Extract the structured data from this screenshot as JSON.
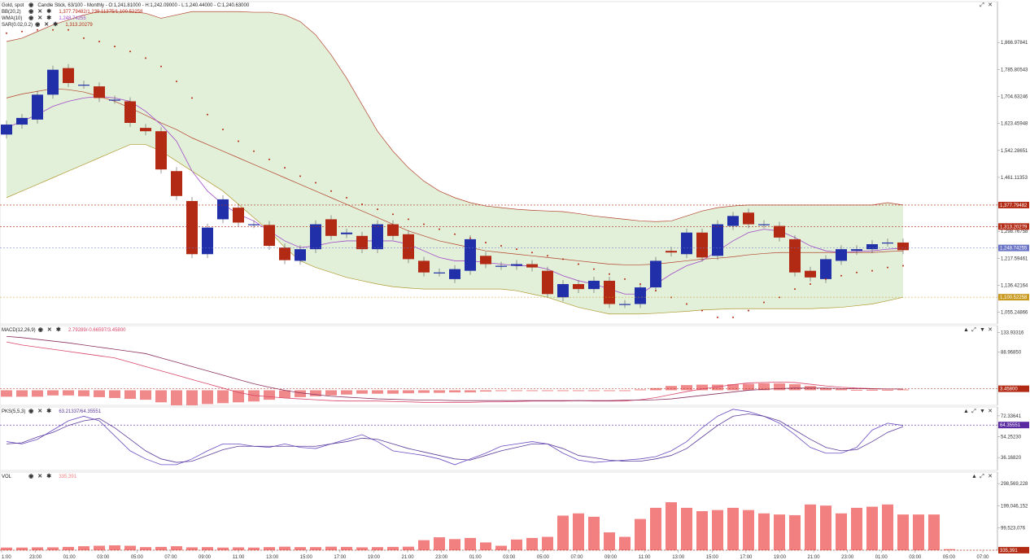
{
  "colors": {
    "up": "#2130a8",
    "down": "#b22a14",
    "band_fill": "#e2efd9",
    "band_line": "#b4442c",
    "wma": "#a04bc8",
    "sar": "#b22a14",
    "macd_line": "#d8466a",
    "macd_hist": "#f08a8a",
    "pk_k": "#6a4cc0",
    "pk_d": "#5a3a9a",
    "vol": "#f28080",
    "tag_red": "#b22a14",
    "tag_gold": "#c89a20",
    "tag_blue": "#6a74c6",
    "tag_purple": "#5a2aa0"
  },
  "legend": {
    "main": {
      "name": "Gold, spot",
      "info": "Candle Stick, 63/100 - Monthly - O:1,241.81000 - H:1,242.09000 - L:1,240.44000 - C:1,240.63000"
    },
    "bb": {
      "name": "BB(20,2)",
      "values": "1,377.79482/1,239.11375/1,100.52258"
    },
    "wma": {
      "name": "WMA(10)",
      "values": "1,248.74255"
    },
    "sar": {
      "name": "SAR(0.02,0.2)",
      "values": "1,313.20279"
    },
    "macd": {
      "name": "MACD(12,26,9)",
      "values": "2.79289/-0.66597/3.45800"
    },
    "pks": {
      "name": "PKS(5,5,3)",
      "values": "63.21337/64.35551"
    },
    "vol": {
      "name": "VOL",
      "values": "335,391"
    }
  },
  "icons": {
    "eye": "eye-icon",
    "close": "close-icon",
    "settings": "gear-icon",
    "expand": "expand-icon",
    "collapse": "collapse-icon",
    "up": "arrow-up-icon",
    "down": "arrow-down-icon"
  },
  "chart_data": [
    {
      "type": "candlestick",
      "panel": "price",
      "ylim": [
        1020,
        1990
      ],
      "yticks": [
        "1,866.97841",
        "1,785.80543",
        "1,704.63246",
        "1,623.45948",
        "1,542.28651",
        "1,461.11353",
        "1,379.94056",
        "1,298.76758",
        "1,217.59461",
        "1,136.42164",
        "1,055.24866"
      ],
      "ytick_values": [
        1866.98,
        1785.81,
        1704.63,
        1623.46,
        1542.29,
        1461.11,
        1379.94,
        1298.77,
        1217.59,
        1136.42,
        1055.25
      ],
      "tags": [
        {
          "text": "1,377.79482",
          "value": 1377.79,
          "color": "red"
        },
        {
          "text": "1,313.20279",
          "value": 1313.2,
          "color": "red"
        },
        {
          "text": "1,248.74255",
          "value": 1248.74,
          "color": "blue"
        },
        {
          "text": "1,100.52258",
          "value": 1100.52,
          "color": "gold"
        }
      ],
      "candles": [
        {
          "o": 1590,
          "c": 1620
        },
        {
          "o": 1620,
          "c": 1640
        },
        {
          "o": 1635,
          "c": 1710
        },
        {
          "o": 1710,
          "c": 1785
        },
        {
          "o": 1790,
          "c": 1745
        },
        {
          "o": 1740,
          "c": 1740
        },
        {
          "o": 1735,
          "c": 1700
        },
        {
          "o": 1695,
          "c": 1695
        },
        {
          "o": 1690,
          "c": 1625
        },
        {
          "o": 1610,
          "c": 1600
        },
        {
          "o": 1600,
          "c": 1485
        },
        {
          "o": 1480,
          "c": 1405
        },
        {
          "o": 1390,
          "c": 1230
        },
        {
          "o": 1230,
          "c": 1310
        },
        {
          "o": 1335,
          "c": 1395
        },
        {
          "o": 1370,
          "c": 1325
        },
        {
          "o": 1320,
          "c": 1320
        },
        {
          "o": 1318,
          "c": 1255
        },
        {
          "o": 1250,
          "c": 1212
        },
        {
          "o": 1210,
          "c": 1245
        },
        {
          "o": 1245,
          "c": 1320
        },
        {
          "o": 1335,
          "c": 1285
        },
        {
          "o": 1290,
          "c": 1295
        },
        {
          "o": 1285,
          "c": 1245
        },
        {
          "o": 1245,
          "c": 1320
        },
        {
          "o": 1320,
          "c": 1285
        },
        {
          "o": 1290,
          "c": 1215
        },
        {
          "o": 1210,
          "c": 1175
        },
        {
          "o": 1175,
          "c": 1175
        },
        {
          "o": 1155,
          "c": 1185
        },
        {
          "o": 1180,
          "c": 1275
        },
        {
          "o": 1225,
          "c": 1200
        },
        {
          "o": 1195,
          "c": 1195
        },
        {
          "o": 1195,
          "c": 1200
        },
        {
          "o": 1200,
          "c": 1190
        },
        {
          "o": 1180,
          "c": 1110
        },
        {
          "o": 1100,
          "c": 1140
        },
        {
          "o": 1140,
          "c": 1125
        },
        {
          "o": 1125,
          "c": 1150
        },
        {
          "o": 1150,
          "c": 1080
        },
        {
          "o": 1080,
          "c": 1080
        },
        {
          "o": 1080,
          "c": 1130
        },
        {
          "o": 1130,
          "c": 1210
        },
        {
          "o": 1240,
          "c": 1235
        },
        {
          "o": 1230,
          "c": 1295
        },
        {
          "o": 1295,
          "c": 1220
        },
        {
          "o": 1225,
          "c": 1320
        },
        {
          "o": 1315,
          "c": 1345
        },
        {
          "o": 1355,
          "c": 1320
        },
        {
          "o": 1320,
          "c": 1320
        },
        {
          "o": 1315,
          "c": 1280
        },
        {
          "o": 1275,
          "c": 1175
        },
        {
          "o": 1180,
          "c": 1160
        },
        {
          "o": 1155,
          "c": 1215
        },
        {
          "o": 1210,
          "c": 1245
        },
        {
          "o": 1240,
          "c": 1245
        },
        {
          "o": 1245,
          "c": 1260
        },
        {
          "o": 1265,
          "c": 1265
        },
        {
          "o": 1265,
          "c": 1242
        }
      ],
      "bb_upper": [
        1870,
        1880,
        1900,
        1920,
        1935,
        1950,
        1960,
        1960,
        1960,
        1955,
        1940,
        1950,
        1960,
        1960,
        1960,
        1960,
        1958,
        1958,
        1950,
        1930,
        1890,
        1830,
        1760,
        1680,
        1600,
        1540,
        1490,
        1450,
        1420,
        1400,
        1385,
        1375,
        1370,
        1365,
        1362,
        1360,
        1358,
        1352,
        1345,
        1340,
        1335,
        1330,
        1328,
        1330,
        1345,
        1360,
        1370,
        1375,
        1378,
        1378,
        1378,
        1378,
        1378,
        1378,
        1378,
        1378,
        1378,
        1385,
        1378
      ],
      "bb_mid": [
        1700,
        1712,
        1720,
        1728,
        1725,
        1718,
        1705,
        1690,
        1670,
        1648,
        1625,
        1605,
        1580,
        1560,
        1540,
        1520,
        1500,
        1480,
        1460,
        1440,
        1420,
        1400,
        1380,
        1360,
        1340,
        1320,
        1300,
        1285,
        1270,
        1260,
        1250,
        1240,
        1235,
        1230,
        1225,
        1220,
        1215,
        1210,
        1205,
        1200,
        1198,
        1198,
        1200,
        1205,
        1210,
        1215,
        1218,
        1222,
        1228,
        1232,
        1235,
        1235,
        1235,
        1235,
        1235,
        1235,
        1235,
        1238,
        1240
      ],
      "bb_lower": [
        1400,
        1420,
        1440,
        1460,
        1480,
        1500,
        1520,
        1540,
        1560,
        1560,
        1540,
        1510,
        1480,
        1450,
        1420,
        1380,
        1340,
        1300,
        1250,
        1210,
        1190,
        1175,
        1160,
        1150,
        1140,
        1132,
        1128,
        1125,
        1125,
        1125,
        1125,
        1125,
        1125,
        1120,
        1110,
        1100,
        1085,
        1070,
        1060,
        1050,
        1050,
        1050,
        1052,
        1055,
        1058,
        1062,
        1064,
        1066,
        1066,
        1066,
        1066,
        1066,
        1066,
        1068,
        1070,
        1075,
        1080,
        1090,
        1100
      ],
      "wma": [
        1610,
        1630,
        1650,
        1675,
        1690,
        1700,
        1705,
        1700,
        1690,
        1660,
        1620,
        1570,
        1480,
        1420,
        1380,
        1350,
        1330,
        1300,
        1270,
        1250,
        1255,
        1265,
        1270,
        1270,
        1270,
        1270,
        1260,
        1240,
        1220,
        1210,
        1210,
        1205,
        1200,
        1195,
        1195,
        1185,
        1165,
        1150,
        1140,
        1125,
        1110,
        1110,
        1140,
        1170,
        1195,
        1210,
        1240,
        1270,
        1295,
        1305,
        1300,
        1280,
        1255,
        1240,
        1235,
        1238,
        1240,
        1245,
        1248
      ],
      "sar": [
        1895,
        1900,
        1905,
        1905,
        1905,
        1880,
        1870,
        1855,
        1840,
        1820,
        1795,
        1750,
        1700,
        1650,
        1605,
        1570,
        1540,
        1515,
        1490,
        1465,
        1445,
        1420,
        1400,
        1380,
        1365,
        1350,
        1335,
        1320,
        1305,
        1290,
        1278,
        1265,
        1255,
        1245,
        1235,
        1225,
        1215,
        1200,
        1185,
        1170,
        1155,
        1140,
        1120,
        1100,
        1080,
        1060,
        1040,
        1040,
        1060,
        1085,
        1100,
        1125,
        1140,
        1155,
        1165,
        1175,
        1180,
        1190,
        1195
      ]
    },
    {
      "type": "bar+line",
      "panel": "macd",
      "ylim": [
        -35,
        150
      ],
      "yticks": [
        "133.93316",
        "88.96850"
      ],
      "ytick_values": [
        133.93,
        88.97
      ],
      "tags": [
        {
          "text": "3.45800",
          "value": 3.458,
          "color": "red"
        }
      ],
      "hist": [
        -15,
        -15,
        -15,
        -12,
        -12,
        -14,
        -16,
        -18,
        -20,
        -22,
        -28,
        -35,
        -35,
        -32,
        -30,
        -28,
        -26,
        -22,
        -18,
        -16,
        -14,
        -12,
        -10,
        -8,
        -8,
        -8,
        -7,
        -6,
        -6,
        -5,
        -5,
        -3,
        -2,
        -1,
        -1,
        0,
        0,
        0,
        0,
        0,
        -1,
        2,
        5,
        10,
        12,
        13,
        13,
        14,
        15,
        16,
        16,
        14,
        10,
        5,
        3,
        1,
        1,
        1,
        2
      ],
      "macd": [
        112,
        105,
        100,
        95,
        90,
        85,
        80,
        75,
        65,
        55,
        45,
        35,
        25,
        15,
        5,
        -5,
        -12,
        -15,
        -18,
        -20,
        -22,
        -24,
        -25,
        -25,
        -25,
        -26,
        -27,
        -28,
        -28,
        -28,
        -28,
        -27,
        -27,
        -26,
        -25,
        -25,
        -25,
        -24,
        -25,
        -25,
        -25,
        -22,
        -17,
        -10,
        -3,
        3,
        8,
        13,
        17,
        18,
        19,
        18,
        14,
        10,
        7,
        5,
        4,
        3,
        3
      ],
      "signal": [
        125,
        122,
        118,
        114,
        110,
        105,
        100,
        95,
        90,
        85,
        75,
        65,
        55,
        45,
        35,
        25,
        15,
        7,
        0,
        -6,
        -10,
        -14,
        -16,
        -18,
        -20,
        -21,
        -22,
        -23,
        -23,
        -24,
        -24,
        -24,
        -24,
        -24,
        -24,
        -24,
        -24,
        -24,
        -24,
        -24,
        -23,
        -23,
        -22,
        -20,
        -16,
        -12,
        -8,
        -4,
        0,
        2,
        4,
        5,
        5,
        5,
        4,
        4,
        3,
        3,
        3
      ]
    },
    {
      "type": "line",
      "panel": "pks",
      "ylim": [
        25,
        80
      ],
      "yticks": [
        "72.33641",
        "54.25230",
        "36.16820"
      ],
      "ytick_values": [
        72.34,
        54.25,
        36.17
      ],
      "tags": [
        {
          "text": "64.35551",
          "value": 64.36,
          "color": "purple"
        }
      ],
      "k": [
        50,
        48,
        52,
        60,
        68,
        72,
        68,
        55,
        42,
        35,
        30,
        30,
        35,
        42,
        48,
        48,
        46,
        45,
        48,
        45,
        44,
        48,
        52,
        56,
        50,
        42,
        40,
        38,
        35,
        30,
        35,
        40,
        46,
        48,
        50,
        48,
        40,
        34,
        32,
        33,
        34,
        35,
        37,
        42,
        50,
        62,
        72,
        78,
        76,
        72,
        66,
        56,
        45,
        40,
        40,
        45,
        60,
        66,
        64
      ],
      "d": [
        48,
        49,
        54,
        58,
        64,
        68,
        70,
        62,
        52,
        42,
        35,
        32,
        33,
        38,
        43,
        46,
        46,
        46,
        46,
        46,
        46,
        48,
        50,
        53,
        52,
        48,
        44,
        41,
        38,
        35,
        34,
        38,
        42,
        45,
        48,
        48,
        44,
        38,
        36,
        34,
        33,
        33,
        35,
        38,
        44,
        54,
        64,
        72,
        74,
        72,
        68,
        60,
        52,
        45,
        42,
        43,
        50,
        58,
        63
      ]
    },
    {
      "type": "bar",
      "panel": "volume",
      "ylim": [
        0,
        350000000
      ],
      "yticks": [
        "298,569,228",
        "199,046,152",
        "99,523,076"
      ],
      "ytick_values": [
        298569228,
        199046152,
        99523076
      ],
      "tags": [
        {
          "text": "335,391",
          "value": 335391,
          "color": "red"
        }
      ],
      "values": [
        12000000,
        12000000,
        13000000,
        13000000,
        15000000,
        18000000,
        20000000,
        22000000,
        20000000,
        14000000,
        15000000,
        18000000,
        13000000,
        14000000,
        12000000,
        13000000,
        12000000,
        14000000,
        16000000,
        14000000,
        14000000,
        16000000,
        15000000,
        13000000,
        14000000,
        15000000,
        16000000,
        45000000,
        58000000,
        50000000,
        55000000,
        35000000,
        20000000,
        48000000,
        55000000,
        60000000,
        155000000,
        165000000,
        150000000,
        80000000,
        60000000,
        140000000,
        190000000,
        215000000,
        190000000,
        175000000,
        180000000,
        190000000,
        180000000,
        165000000,
        160000000,
        157000000,
        205000000,
        200000000,
        165000000,
        190000000,
        195000000,
        205000000,
        160000000,
        160000000,
        160000000,
        5000000
      ]
    }
  ],
  "x_ticks": [
    "1:00",
    "23:00",
    "01:00",
    "03:00",
    "05:00",
    "07:00",
    "09:00",
    "11:00",
    "13:00",
    "15:00",
    "17:00",
    "19:00",
    "21:00",
    "23:00",
    "01:00",
    "03:00",
    "05:00",
    "07:00",
    "09:00",
    "11:00",
    "13:00",
    "15:00",
    "17:00",
    "19:00",
    "21:00",
    "23:00",
    "01:00",
    "03:00",
    "05:00",
    "07:00"
  ]
}
